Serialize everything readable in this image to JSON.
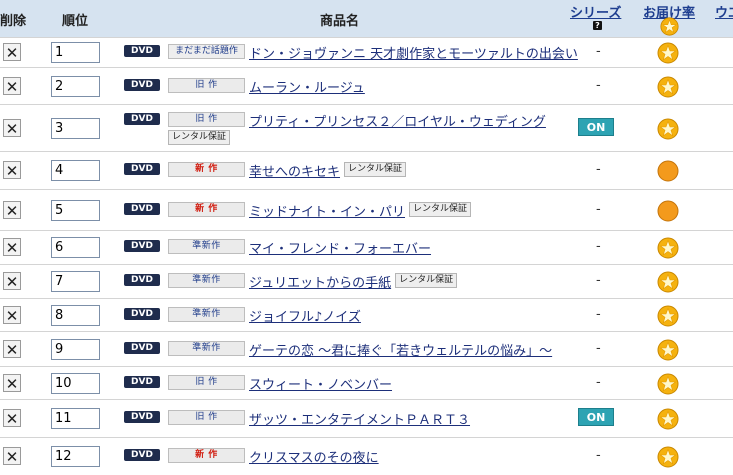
{
  "header": {
    "delete": "削除",
    "rank": "順位",
    "product": "商品名",
    "series": "シリーズ",
    "delivery": "お届け率",
    "extra": "ウエ",
    "help": "?"
  },
  "rows": [
    {
      "rank": "1",
      "media": "DVD",
      "category": "まだまだ話題作",
      "category_type": "hot",
      "title": "ドン・ジョヴァンニ 天才劇作家とモーツァルトの出会い",
      "guarantee": "",
      "series": "-",
      "delivery": "star"
    },
    {
      "rank": "2",
      "media": "DVD",
      "category": "旧 作",
      "category_type": "old",
      "title": "ムーラン・ルージュ",
      "guarantee": "",
      "series": "-",
      "delivery": "star"
    },
    {
      "rank": "3",
      "media": "DVD",
      "category": "旧 作",
      "category_type": "old",
      "title": "プリティ・プリンセス２／ロイヤル・ウェディング",
      "guarantee": "レンタル保証",
      "series": "ON",
      "delivery": "star"
    },
    {
      "rank": "4",
      "media": "DVD",
      "category": "新 作",
      "category_type": "new",
      "title": "幸せへのキセキ",
      "guarantee": "レンタル保証",
      "series": "-",
      "delivery": "circle"
    },
    {
      "rank": "5",
      "media": "DVD",
      "category": "新 作",
      "category_type": "new",
      "title": "ミッドナイト・イン・パリ",
      "guarantee": "レンタル保証",
      "series": "-",
      "delivery": "circle"
    },
    {
      "rank": "6",
      "media": "DVD",
      "category": "準新作",
      "category_type": "semi",
      "title": "マイ・フレンド・フォーエバー",
      "guarantee": "",
      "series": "-",
      "delivery": "star"
    },
    {
      "rank": "7",
      "media": "DVD",
      "category": "準新作",
      "category_type": "semi",
      "title": "ジュリエットからの手紙",
      "guarantee": "レンタル保証",
      "series": "-",
      "delivery": "star"
    },
    {
      "rank": "8",
      "media": "DVD",
      "category": "準新作",
      "category_type": "semi",
      "title": "ジョイフル♪ノイズ",
      "guarantee": "",
      "series": "-",
      "delivery": "star"
    },
    {
      "rank": "9",
      "media": "DVD",
      "category": "準新作",
      "category_type": "semi",
      "title": "ゲーテの恋 〜君に捧ぐ「若きウェルテルの悩み」〜",
      "guarantee": "",
      "series": "-",
      "delivery": "star"
    },
    {
      "rank": "10",
      "media": "DVD",
      "category": "旧 作",
      "category_type": "old",
      "title": "スウィート・ノベンバー",
      "guarantee": "",
      "series": "-",
      "delivery": "star"
    },
    {
      "rank": "11",
      "media": "DVD",
      "category": "旧 作",
      "category_type": "old",
      "title": "ザッツ・エンタテイメントＰＡＲＴ３",
      "guarantee": "",
      "series": "ON",
      "delivery": "star"
    },
    {
      "rank": "12",
      "media": "DVD",
      "category": "新 作",
      "category_type": "new",
      "title": "クリスマスのその夜に",
      "guarantee": "",
      "series": "-",
      "delivery": "star"
    }
  ],
  "colors": {
    "header_bg": "#d6e3f0",
    "link": "#1d2f7a",
    "new": "#d11d10",
    "on_badge": "#2da3b3",
    "star": "#f5b20f"
  }
}
